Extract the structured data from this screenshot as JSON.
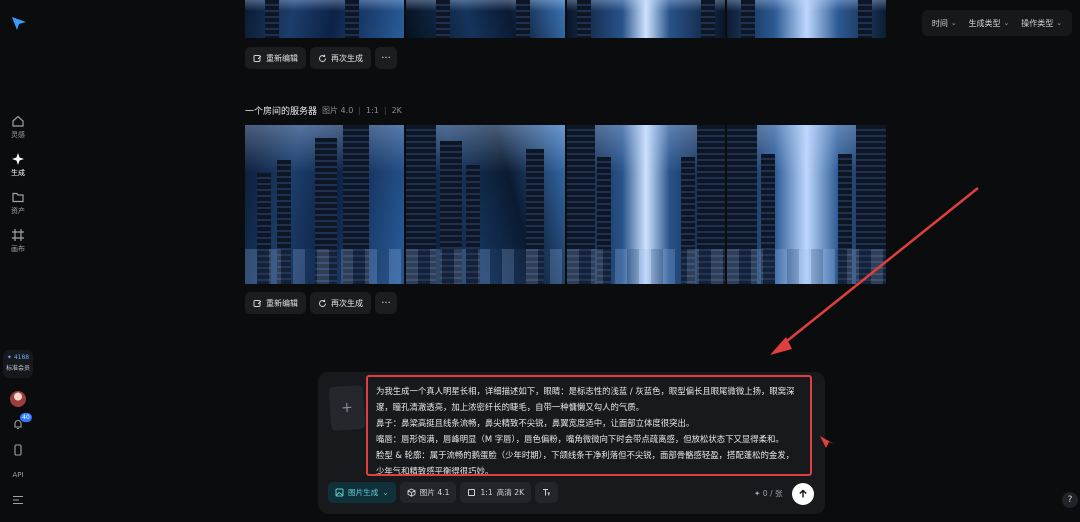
{
  "sidebar": {
    "items": [
      {
        "label": "灵感",
        "icon": "home-icon"
      },
      {
        "label": "生成",
        "icon": "sparkle-icon"
      },
      {
        "label": "资产",
        "icon": "folder-icon"
      },
      {
        "label": "画布",
        "icon": "canvas-icon"
      }
    ],
    "member": {
      "credits": "✦ 4188",
      "tier": "标准会员"
    },
    "notification_count": "40",
    "api_label": "API"
  },
  "filters": [
    {
      "label": "时间"
    },
    {
      "label": "生成类型"
    },
    {
      "label": "操作类型"
    }
  ],
  "actions": {
    "reedit": "重新编辑",
    "regenerate": "再次生成",
    "more": "···"
  },
  "section": {
    "title": "一个房间的服务器",
    "type": "图片 4.0",
    "ratio": "1:1",
    "resolution": "2K"
  },
  "prompt": {
    "add": "+",
    "lines": [
      "为我生成一个真人明星长相，详细描述如下，眼睛：是标志性的浅蓝 / 灰蓝色，眼型偏长且眼尾微微上扬，眼窝深邃，瞳孔清澈透亮，加上浓密纤长的睫毛，自带一种慵懒又勾人的气质。",
      "鼻子：鼻梁高挺且线条流畅，鼻尖精致不尖锐，鼻翼宽度适中，让面部立体度很突出。",
      "嘴唇：唇形饱满，唇峰明显（M 字唇），唇色偏粉，嘴角微微向下时会带点疏离感，但放松状态下又显得柔和。",
      "脸型 & 轮廓：属于流畅的鹅蛋脸（少年时期），下颌线条干净利落但不尖锐，面部骨骼感轻盈，搭配蓬松的金发，少年气和精致感平衡得很巧妙。"
    ]
  },
  "toolbar": {
    "mode": "图片生成",
    "model": "图片 4.1",
    "ratio": "1:1",
    "quality": "高清 2K",
    "counter": "✦ 0 / 张"
  },
  "help": "?"
}
